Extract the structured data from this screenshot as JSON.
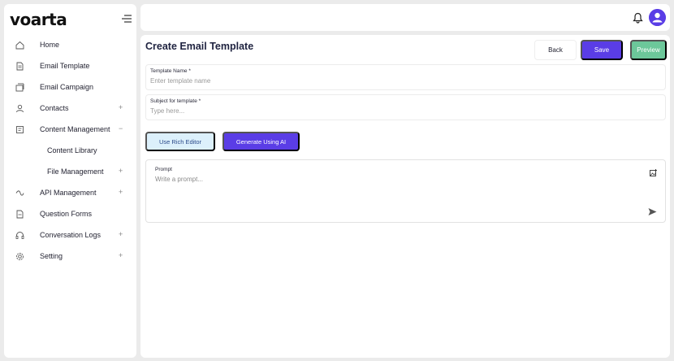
{
  "app": {
    "logo_text": "voarta"
  },
  "sidebar": {
    "items": [
      {
        "label": "Home",
        "icon": "home-icon"
      },
      {
        "label": "Email Template",
        "icon": "document-icon"
      },
      {
        "label": "Email Campaign",
        "icon": "campaign-icon"
      },
      {
        "label": "Contacts",
        "icon": "contacts-icon",
        "toggle": "+"
      },
      {
        "label": "Content Management",
        "icon": "content-icon",
        "toggle": "−"
      },
      {
        "label": "Content Library"
      },
      {
        "label": "File Management",
        "toggle": "+"
      },
      {
        "label": "API Management",
        "icon": "api-icon",
        "toggle": "+"
      },
      {
        "label": "Question Forms",
        "icon": "forms-icon"
      },
      {
        "label": "Conversation Logs",
        "icon": "headset-icon",
        "toggle": "+"
      },
      {
        "label": "Setting",
        "icon": "gear-icon",
        "toggle": "+"
      }
    ]
  },
  "page": {
    "title": "Create Email Template",
    "back_label": "Back",
    "save_label": "Save",
    "preview_label": "Preview"
  },
  "form": {
    "template_name": {
      "label": "Template Name *",
      "placeholder": "Enter template name",
      "value": ""
    },
    "subject": {
      "label": "Subject for template *",
      "placeholder": "Type here...",
      "value": ""
    },
    "rich_editor_label": "Use Rich Editor",
    "generate_ai_label": "Generate Using AI",
    "prompt": {
      "label": "Prompt",
      "placeholder": "Write a prompt..."
    }
  },
  "colors": {
    "primary": "#5a3de6",
    "preview": "#6cc79a",
    "rich_editor_bg": "#dcf0fb",
    "background": "#ebebeb"
  }
}
